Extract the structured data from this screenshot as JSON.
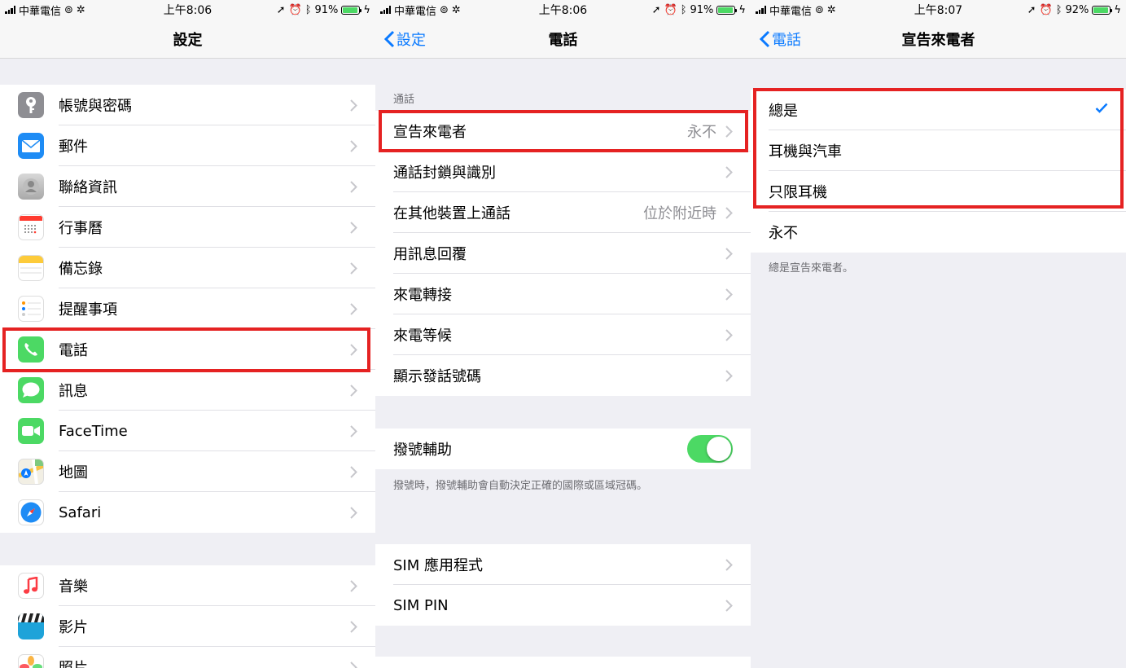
{
  "status": {
    "s1": {
      "carrier": "中華電信",
      "time": "上午8:06",
      "battery": "91%",
      "battery_level": 0.91
    },
    "s2": {
      "carrier": "中華電信",
      "time": "上午8:06",
      "battery": "91%",
      "battery_level": 0.91
    },
    "s3": {
      "carrier": "中華電信",
      "time": "上午8:07",
      "battery": "92%",
      "battery_level": 0.92
    }
  },
  "screen1": {
    "title": "設定",
    "items": [
      {
        "label": "帳號與密碼",
        "icon": "key-icon"
      },
      {
        "label": "郵件",
        "icon": "mail-icon"
      },
      {
        "label": "聯絡資訊",
        "icon": "contacts-icon"
      },
      {
        "label": "行事曆",
        "icon": "calendar-icon"
      },
      {
        "label": "備忘錄",
        "icon": "notes-icon"
      },
      {
        "label": "提醒事項",
        "icon": "reminders-icon"
      },
      {
        "label": "電話",
        "icon": "phone-icon"
      },
      {
        "label": "訊息",
        "icon": "messages-icon"
      },
      {
        "label": "FaceTime",
        "icon": "facetime-icon"
      },
      {
        "label": "地圖",
        "icon": "maps-icon"
      },
      {
        "label": "Safari",
        "icon": "safari-icon"
      }
    ],
    "items2": [
      {
        "label": "音樂",
        "icon": "music-icon"
      },
      {
        "label": "影片",
        "icon": "videos-icon"
      },
      {
        "label": "照片",
        "icon": "photos-icon"
      }
    ]
  },
  "screen2": {
    "back": "設定",
    "title": "電話",
    "section_header": "通話",
    "items": [
      {
        "label": "宣告來電者",
        "value": "永不"
      },
      {
        "label": "通話封鎖與識別",
        "value": ""
      },
      {
        "label": "在其他裝置上通話",
        "value": "位於附近時"
      },
      {
        "label": "用訊息回覆",
        "value": ""
      },
      {
        "label": "來電轉接",
        "value": ""
      },
      {
        "label": "來電等候",
        "value": ""
      },
      {
        "label": "顯示發話號碼",
        "value": ""
      }
    ],
    "dial_assist": {
      "label": "撥號輔助",
      "on": true,
      "footer": "撥號時，撥號輔助會自動決定正確的國際或區域冠碼。"
    },
    "sim_items": [
      {
        "label": "SIM 應用程式"
      },
      {
        "label": "SIM PIN"
      }
    ]
  },
  "screen3": {
    "back": "電話",
    "title": "宣告來電者",
    "options": [
      {
        "label": "總是",
        "checked": true
      },
      {
        "label": "耳機與汽車",
        "checked": false
      },
      {
        "label": "只限耳機",
        "checked": false
      },
      {
        "label": "永不",
        "checked": false
      }
    ],
    "footer": "總是宣告來電者。"
  },
  "colors": {
    "accent": "#0a7aff",
    "highlight": "#e52222",
    "toggle_on": "#4cd964"
  }
}
